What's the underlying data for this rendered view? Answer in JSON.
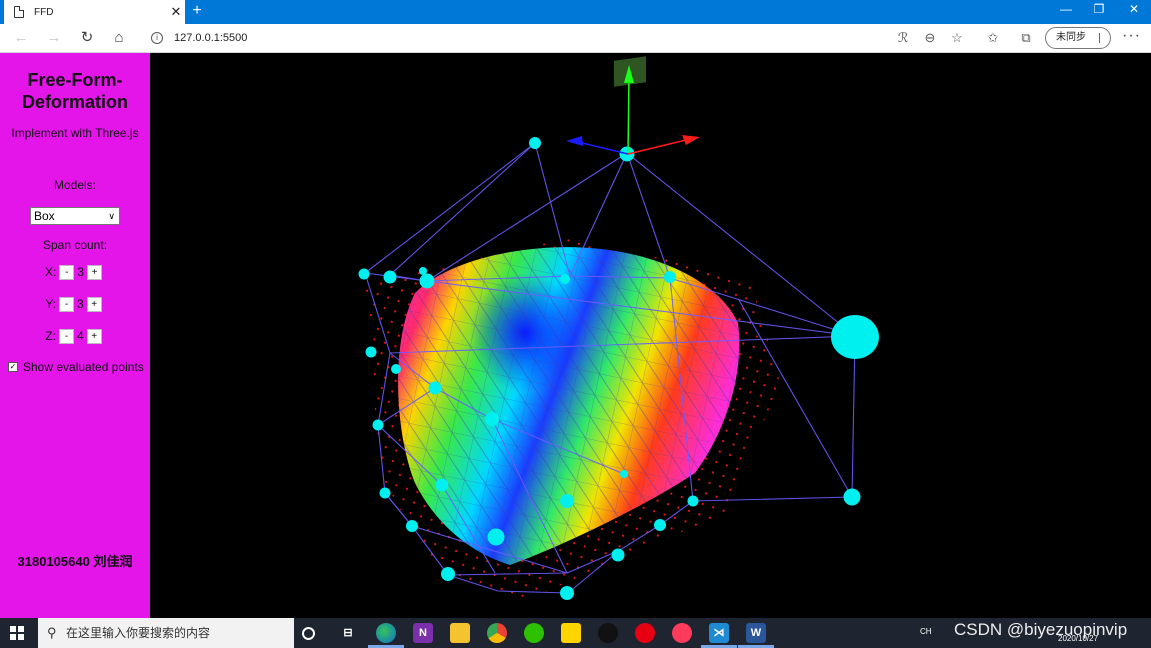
{
  "browser": {
    "tab_title": "FFD",
    "tab_close": "✕",
    "new_tab": "+",
    "url": "127.0.0.1:5500",
    "sync_label": "未同步",
    "more": "···",
    "minimize": "—",
    "restore": "❐",
    "close": "✕"
  },
  "panel": {
    "title": "Free-Form-Deformation",
    "subtitle": "Implement with Three.js",
    "models_label": "Models:",
    "model_selected": "Box",
    "span_label": "Span count:",
    "axes": [
      {
        "label": "X:",
        "minus": "-",
        "value": "3",
        "plus": "+"
      },
      {
        "label": "Y:",
        "minus": "-",
        "value": "3",
        "plus": "+"
      },
      {
        "label": "Z:",
        "minus": "-",
        "value": "4",
        "plus": "+"
      }
    ],
    "show_points_label": "Show evaluated points",
    "show_points_checked": true,
    "author": "3180105640 刘佳润",
    "bg_color": "#e315e9"
  },
  "scene": {
    "background": "#000000",
    "control_point_color": "#00f0f0",
    "lattice_color": "#6a5cff",
    "evaluated_point_color": "#ff1a1a",
    "gizmo_axes": [
      "x-red",
      "y-green",
      "z-blue"
    ]
  },
  "taskbar": {
    "search_placeholder": "在这里输入你要搜索的内容",
    "ime": "CH",
    "date": "2020/10/27"
  },
  "watermark": "CSDN @biyezuopinvip"
}
